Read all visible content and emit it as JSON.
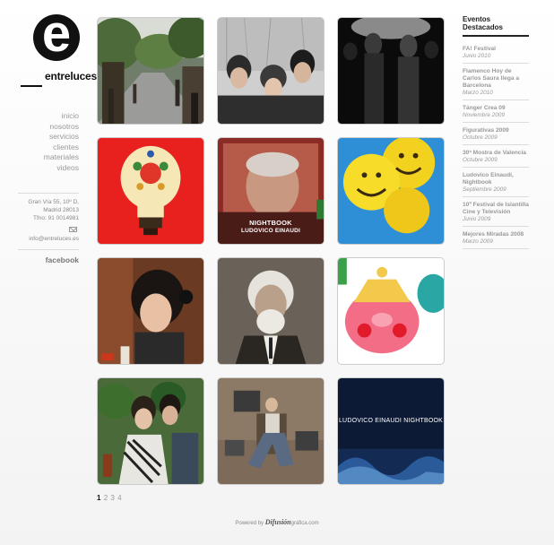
{
  "brand": {
    "logo_letter": "e",
    "name": "entreluces"
  },
  "nav": {
    "items": [
      "inicio",
      "nosotros",
      "servicios",
      "clientes",
      "materiales",
      "videos"
    ]
  },
  "contact": {
    "address_line1": "Gran Vía 55, 10º D,",
    "address_line2": "Madrid 28013",
    "phone": "Tfno: 91 0014981",
    "email": "info@entreluces.es",
    "facebook": "facebook"
  },
  "gallery": {
    "tiles": [
      {
        "subject": "street-photo"
      },
      {
        "subject": "band-photo"
      },
      {
        "subject": "crowd-photo"
      },
      {
        "subject": "lightbulb-illustration"
      },
      {
        "subject": "nightbook-poster",
        "title": "NIGHTBOOK",
        "subtitle": "LUDOVICO EINAUDI"
      },
      {
        "subject": "smiley-balloons"
      },
      {
        "subject": "woman-headphones"
      },
      {
        "subject": "old-man-portrait"
      },
      {
        "subject": "pig-illustration"
      },
      {
        "subject": "couple-photo"
      },
      {
        "subject": "man-in-armchair"
      },
      {
        "subject": "nightbook-cover",
        "title": "LUDOVICO EINAUDI NIGHTBOOK"
      }
    ]
  },
  "pagination": {
    "pages": [
      "1",
      "2",
      "3",
      "4"
    ],
    "current": "1"
  },
  "footer": {
    "powered_by": "Powered by",
    "brand_part1": "Difusión",
    "brand_part2": "gráfica.com"
  },
  "events": {
    "title": "Eventos Destacados",
    "items": [
      {
        "name": "FA! Festival",
        "date": "Junio 2010"
      },
      {
        "name": "Flamenco Hoy de Carlos Saura llega a Barcelona",
        "date": "Marzo 2010"
      },
      {
        "name": "Tánger Crea 09",
        "date": "Noviembre 2009"
      },
      {
        "name": "Figurativas 2009",
        "date": "Octubre 2009"
      },
      {
        "name": "30ª Mostra de Valencia",
        "date": "Octubre 2009"
      },
      {
        "name": "Ludovico Einaudi, Nightbook",
        "date": "Septiembre 2009"
      },
      {
        "name": "10º Festival de Islantilla Cine y Televisión",
        "date": "Junio 2009"
      },
      {
        "name": "Mejores Miradas 2008",
        "date": "Marzo 2009"
      }
    ]
  },
  "colors": {
    "accent": "#111111",
    "text": "#888888",
    "divider": "#dcdcdc"
  }
}
